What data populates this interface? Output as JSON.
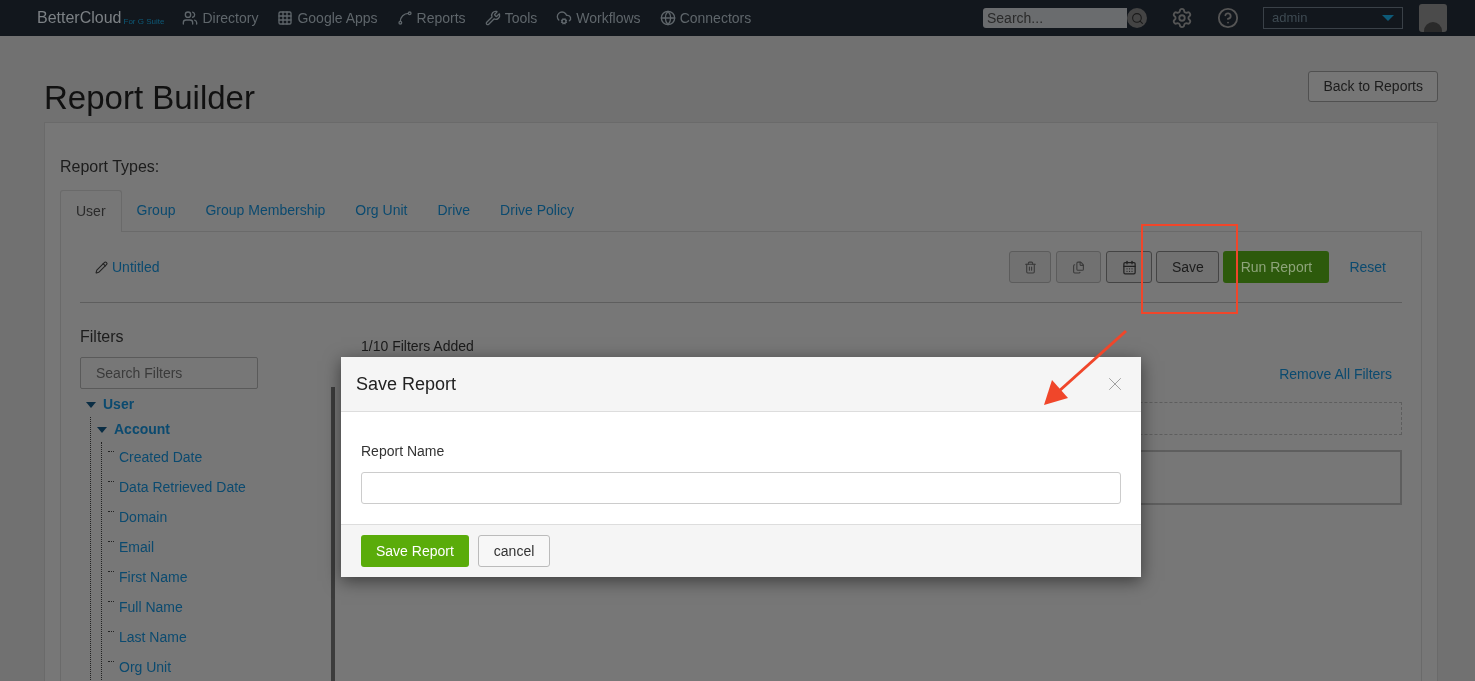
{
  "nav": {
    "logo": "BetterCloud",
    "logo_suffix": "For G Suite",
    "items": [
      {
        "label": "Directory"
      },
      {
        "label": "Google Apps"
      },
      {
        "label": "Reports"
      },
      {
        "label": "Tools"
      },
      {
        "label": "Workflows"
      },
      {
        "label": "Connectors"
      }
    ],
    "search_placeholder": "Search...",
    "user": "admin"
  },
  "page": {
    "title": "Report Builder",
    "back_button": "Back to Reports"
  },
  "report_types": {
    "label": "Report Types:",
    "tabs": [
      {
        "label": "User",
        "selected": true
      },
      {
        "label": "Group",
        "selected": false
      },
      {
        "label": "Group Membership",
        "selected": false
      },
      {
        "label": "Org Unit",
        "selected": false
      },
      {
        "label": "Drive",
        "selected": false
      },
      {
        "label": "Drive Policy",
        "selected": false
      }
    ]
  },
  "report": {
    "name": "Untitled",
    "save": "Save",
    "run": "Run Report",
    "reset": "Reset"
  },
  "filters": {
    "heading": "Filters",
    "search_placeholder": "Search Filters",
    "tree": [
      {
        "label": "User",
        "expanded": true,
        "children": [
          {
            "label": "Account",
            "expanded": true,
            "children": [
              {
                "label": "Created Date"
              },
              {
                "label": "Data Retrieved Date"
              },
              {
                "label": "Domain"
              },
              {
                "label": "Email"
              },
              {
                "label": "First Name"
              },
              {
                "label": "Full Name"
              },
              {
                "label": "Last Name"
              },
              {
                "label": "Org Unit"
              }
            ]
          }
        ]
      }
    ]
  },
  "filter_panel": {
    "count": "1/10 Filters Added",
    "remove_all": "Remove All Filters"
  },
  "dialog": {
    "title": "Save Report",
    "field_label": "Report Name",
    "primary": "Save Report",
    "secondary": "cancel"
  }
}
